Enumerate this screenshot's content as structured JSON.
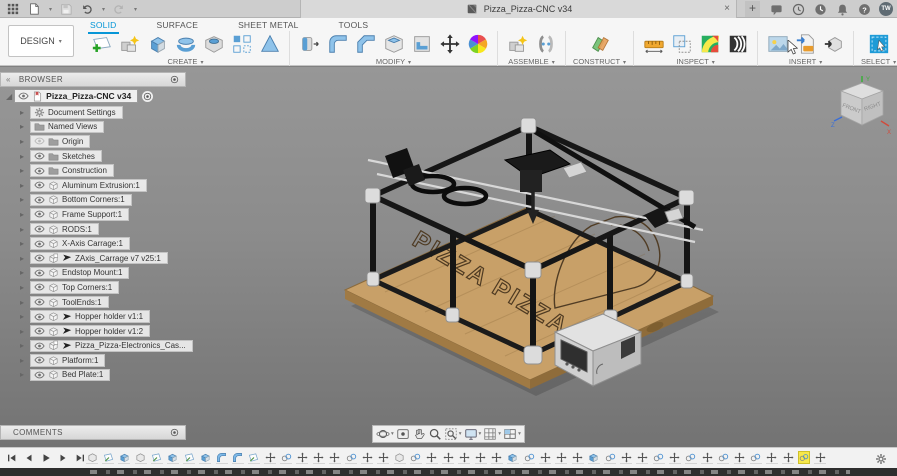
{
  "topbar": {
    "title": "Pizza_Pizza-CNC v34",
    "close_tab": "×",
    "new_tab": "+",
    "avatar": "TW"
  },
  "toolbar": {
    "design_button": {
      "label": "DESIGN"
    },
    "tabs": [
      {
        "label": "SOLID",
        "active": true
      },
      {
        "label": "SURFACE",
        "active": false
      },
      {
        "label": "SHEET METAL",
        "active": false
      },
      {
        "label": "TOOLS",
        "active": false
      }
    ],
    "groups": [
      {
        "label": "CREATE",
        "icons": [
          "create-sketch",
          "create-form",
          "extrude",
          "revolve",
          "hole",
          "pattern",
          "thread"
        ]
      },
      {
        "label": "MODIFY",
        "icons": [
          "press-pull",
          "fillet",
          "chamfer",
          "shell",
          "scale",
          "move",
          "appearance"
        ]
      },
      {
        "label": "ASSEMBLE",
        "icons": [
          "new-component",
          "joint-tool"
        ]
      },
      {
        "label": "CONSTRUCT",
        "icons": [
          "construction-plane"
        ]
      },
      {
        "label": "INSPECT",
        "icons": [
          "measure",
          "interference",
          "curvature",
          "zebra"
        ]
      },
      {
        "label": "INSERT",
        "icons": [
          "canvas",
          "insert-svg",
          "insert-mesh"
        ]
      },
      {
        "label": "SELECT",
        "icons": [
          "select"
        ]
      }
    ]
  },
  "browser": {
    "header": "BROWSER",
    "root": {
      "label": "Pizza_Pizza-CNC v34"
    },
    "items": [
      {
        "label": "Document Settings",
        "icon": "gear",
        "eye": "none",
        "linked": false
      },
      {
        "label": "Named Views",
        "icon": "folder",
        "eye": "none",
        "linked": false
      },
      {
        "label": "Origin",
        "icon": "folder",
        "eye": "off",
        "linked": false
      },
      {
        "label": "Sketches",
        "icon": "folder",
        "eye": "on",
        "linked": false
      },
      {
        "label": "Construction",
        "icon": "folder",
        "eye": "on",
        "linked": false
      },
      {
        "label": "Aluminum Extrusion:1",
        "icon": "component",
        "eye": "on",
        "linked": false
      },
      {
        "label": "Bottom Corners:1",
        "icon": "component",
        "eye": "on",
        "linked": false
      },
      {
        "label": "Frame Support:1",
        "icon": "component",
        "eye": "on",
        "linked": false
      },
      {
        "label": "RODS:1",
        "icon": "component",
        "eye": "on",
        "linked": false
      },
      {
        "label": "X-Axis Carrage:1",
        "icon": "component",
        "eye": "on",
        "linked": false
      },
      {
        "label": "ZAxis_Carrage v7 v25:1",
        "icon": "component-doc",
        "eye": "on",
        "linked": true
      },
      {
        "label": "Endstop Mount:1",
        "icon": "component",
        "eye": "on",
        "linked": false
      },
      {
        "label": "Top Corners:1",
        "icon": "component",
        "eye": "on",
        "linked": false
      },
      {
        "label": "ToolEnds:1",
        "icon": "component",
        "eye": "on",
        "linked": false
      },
      {
        "label": "Hopper holder v1:1",
        "icon": "component",
        "eye": "on",
        "linked": true
      },
      {
        "label": "Hopper holder v1:2",
        "icon": "component",
        "eye": "on",
        "linked": true
      },
      {
        "label": "Pizza_Pizza-Electronics_Cas...",
        "icon": "component-doc",
        "eye": "on",
        "linked": true
      },
      {
        "label": "Platform:1",
        "icon": "component",
        "eye": "on",
        "linked": false
      },
      {
        "label": "Bed Plate:1",
        "icon": "component",
        "eye": "on",
        "linked": false
      }
    ]
  },
  "viewcube": {
    "face_front": "FRONT",
    "face_right": "RIGHT",
    "axis_x": "X",
    "axis_y": "Y",
    "axis_z": "Z"
  },
  "comments": {
    "header": "COMMENTS"
  },
  "navbar": {
    "buttons": [
      {
        "icon": "orbit",
        "dropdown": true
      },
      {
        "icon": "look-at",
        "dropdown": false
      },
      {
        "icon": "pan",
        "dropdown": false
      },
      {
        "icon": "zoom",
        "dropdown": false
      },
      {
        "icon": "fit",
        "dropdown": true
      },
      {
        "icon": "display-settings",
        "dropdown": true
      },
      {
        "icon": "grid-display",
        "dropdown": true
      },
      {
        "icon": "viewports",
        "dropdown": true
      }
    ]
  },
  "timeline": {
    "playback": [
      "skip-start",
      "step-back",
      "play",
      "step-forward",
      "skip-end"
    ],
    "features": [
      "component",
      "sketch",
      "extrude",
      "component",
      "sketch",
      "extrude",
      "sketch",
      "extrude",
      "fillet",
      "fillet",
      "sketch",
      "move",
      "joint",
      "move",
      "move",
      "move",
      "joint",
      "move",
      "move",
      "component",
      "joint",
      "move",
      "move",
      "move",
      "move",
      "move",
      "extrude",
      "joint",
      "move",
      "move",
      "move",
      "extrude",
      "joint",
      "move",
      "move",
      "joint",
      "move",
      "joint",
      "move",
      "joint",
      "move",
      "joint",
      "move",
      "move",
      "joint-active",
      "move"
    ]
  },
  "model": {
    "engraving": "PIZZA PIZZA"
  },
  "colors": {
    "accent": "#0696d7",
    "timeline_highlight": "#f7e84b",
    "wood": "#c8a068"
  }
}
